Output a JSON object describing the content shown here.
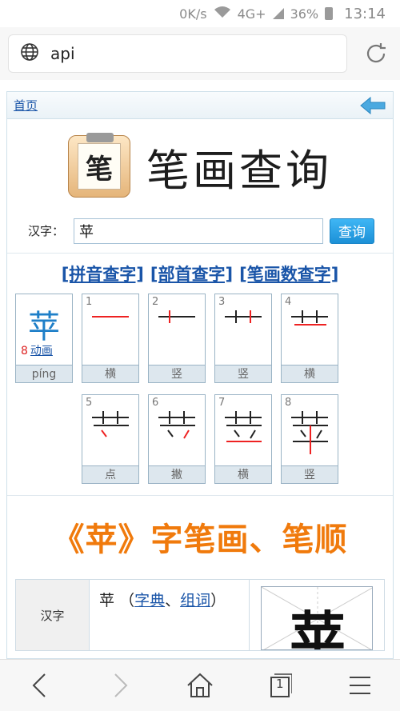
{
  "status": {
    "net": "0K/s",
    "signal": "4G+",
    "battery": "36%",
    "time": "13:14"
  },
  "address": {
    "url": "api"
  },
  "page": {
    "home_link": "首页",
    "title": "笔画查询",
    "logo_char": "笔",
    "search": {
      "label": "汉字：",
      "value": "苹",
      "button": "查询"
    },
    "links": [
      "[拼音查字]",
      "[部首查字]",
      "[笔画数查字]"
    ],
    "char": {
      "glyph": "苹",
      "stroke_count": "8",
      "animate": "动画",
      "pinyin": "píng"
    },
    "strokes": [
      {
        "n": "1",
        "name": "横"
      },
      {
        "n": "2",
        "name": "竖"
      },
      {
        "n": "3",
        "name": "竖"
      },
      {
        "n": "4",
        "name": "横"
      },
      {
        "n": "5",
        "name": "点"
      },
      {
        "n": "6",
        "name": "撇"
      },
      {
        "n": "7",
        "name": "横"
      },
      {
        "n": "8",
        "name": "竖"
      }
    ],
    "heading": "《苹》字笔画、笔顺",
    "info": {
      "key": "汉字",
      "char": "苹",
      "dict": "字典",
      "sep": "、",
      "words": "组词",
      "open": "（",
      "close": "）"
    },
    "colors": {
      "accent_orange": "#f07a0c",
      "link_blue": "#1a55a8",
      "stroke_red": "#e22222"
    }
  },
  "bottom_nav": {
    "icons": [
      "back-icon",
      "forward-icon",
      "home-icon",
      "tabs-icon",
      "menu-icon"
    ],
    "tabs_count": "1"
  }
}
